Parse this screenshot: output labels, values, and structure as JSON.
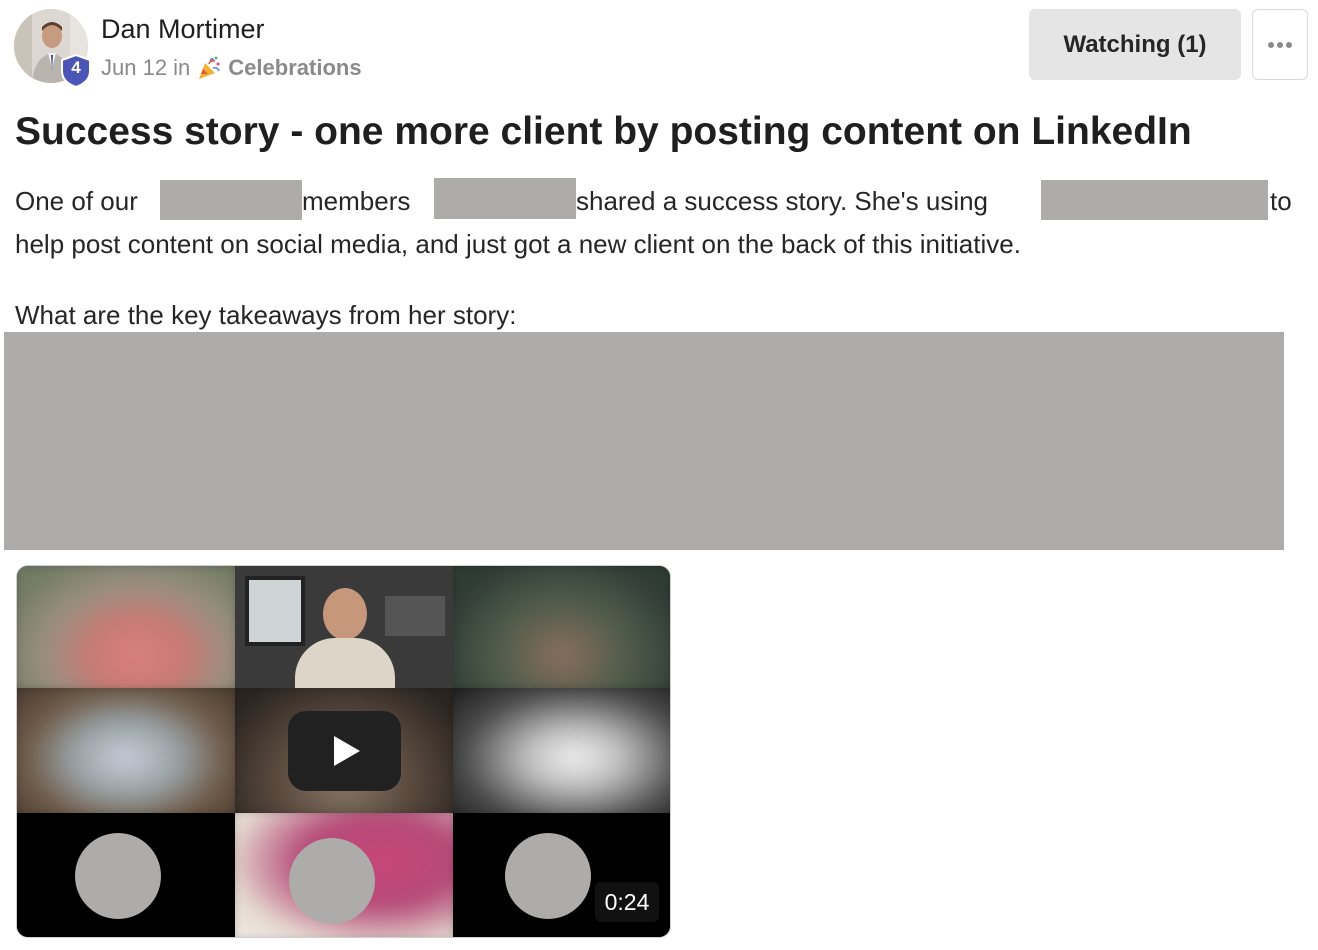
{
  "author": {
    "name": "Dan Mortimer",
    "level": "4",
    "avatar_icon": "person-avatar"
  },
  "meta": {
    "date_in": "Jun 12 in",
    "category_icon": "party-popper-icon",
    "category": "Celebrations"
  },
  "actions": {
    "watching_label": "Watching (1)",
    "more_icon": "ellipsis-icon"
  },
  "post": {
    "title": "Success story - one more client by posting content on LinkedIn",
    "line1": {
      "seg_a": "One of our ",
      "seg_b": " members",
      "seg_c": " shared a success story. She's using ",
      "seg_d": "to"
    },
    "line2": "help post content on social media, and just got a new client on the back of this initiative.",
    "line3": "What are the key takeaways from her story:"
  },
  "video": {
    "duration": "0:24",
    "play_icon": "play-icon"
  },
  "colors": {
    "redaction": "#adacab",
    "badge": "#4a55b5",
    "button_bg": "#e5e5e5"
  }
}
